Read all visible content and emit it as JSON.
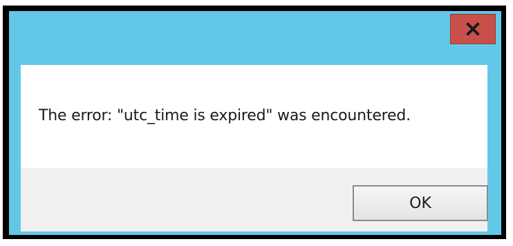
{
  "dialog": {
    "message": "The error: \"utc_time is expired\" was encountered.",
    "ok_label": "OK",
    "close_icon": "close-icon"
  },
  "colors": {
    "title_bar": "#63c8e8",
    "close_button": "#c9504a",
    "content_bg": "#ffffff",
    "footer_bg": "#f0f0f0"
  }
}
